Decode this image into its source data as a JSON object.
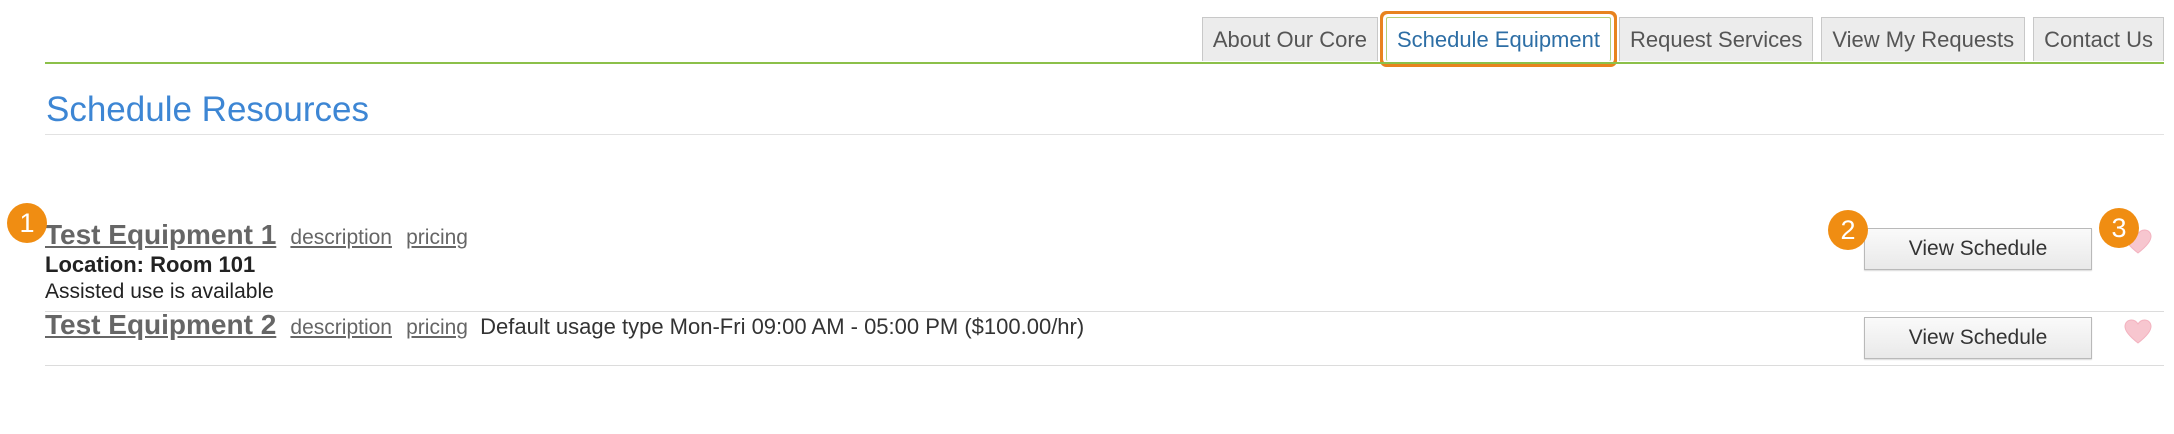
{
  "nav": {
    "tabs": [
      {
        "label": "About Our Core",
        "active": false
      },
      {
        "label": "Schedule Equipment",
        "active": true
      },
      {
        "label": "Request Services",
        "active": false
      },
      {
        "label": "View My Requests",
        "active": false
      },
      {
        "label": "Contact Us",
        "active": false
      }
    ]
  },
  "page": {
    "title": "Schedule Resources"
  },
  "resources": [
    {
      "name": "Test Equipment 1",
      "description_link": "description",
      "pricing_link": "pricing",
      "extra": "",
      "location": "Location: Room 101",
      "assisted": "Assisted use is available",
      "button_label": "View Schedule"
    },
    {
      "name": "Test Equipment 2",
      "description_link": "description",
      "pricing_link": "pricing",
      "extra": "Default usage type Mon-Fri 09:00 AM - 05:00 PM ($100.00/hr)",
      "button_label": "View Schedule"
    }
  ],
  "callouts": [
    "1",
    "2",
    "3"
  ],
  "colors": {
    "accent_blue": "#3d86d4",
    "nav_line_green": "#8cc04a",
    "callout_orange": "#f08d12",
    "highlight_orange": "#e8831e",
    "heart_pink": "#f7c6cf"
  },
  "icons": {
    "favorite": "heart-icon"
  }
}
